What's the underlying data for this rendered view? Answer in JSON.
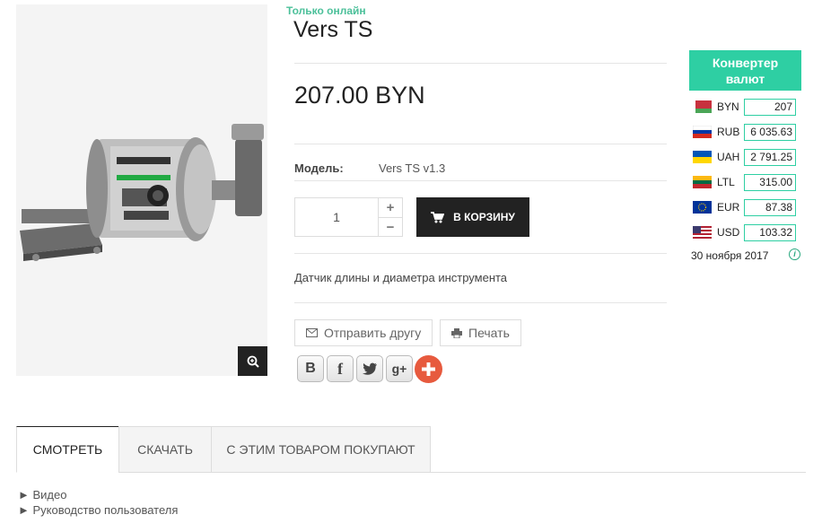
{
  "product": {
    "availability": "Только онлайн",
    "title": "Vers TS",
    "price": "207.00 BYN",
    "model_label": "Модель:",
    "model_value": "Vers TS v1.3",
    "quantity": "1",
    "qty_plus": "+",
    "qty_minus": "−",
    "cart_button": "В КОРЗИНУ",
    "description": "Датчик длины и диаметра инструмента",
    "send_friend": "Отправить другу",
    "print": "Печать"
  },
  "social": [
    "В",
    "f",
    "twitter",
    "g+",
    "+"
  ],
  "converter": {
    "title_line1": "Конвертер",
    "title_line2": "валют",
    "rows": [
      {
        "code": "BYN",
        "value": "207",
        "flag": "by"
      },
      {
        "code": "RUB",
        "value": "6 035.63",
        "flag": "ru"
      },
      {
        "code": "UAH",
        "value": "2 791.25",
        "flag": "ua"
      },
      {
        "code": "LTL",
        "value": "315.00",
        "flag": "lt"
      },
      {
        "code": "EUR",
        "value": "87.38",
        "flag": "eu"
      },
      {
        "code": "USD",
        "value": "103.32",
        "flag": "us"
      }
    ],
    "date": "30 ноября 2017",
    "info_icon": "i"
  },
  "tabs": [
    "СМОТРЕТЬ",
    "СКАЧАТЬ",
    "С ЭТИМ ТОВАРОМ ПОКУПАЮТ"
  ],
  "links": [
    "► Видео",
    "► Руководство пользователя"
  ],
  "icons": {
    "zoom": "zoom-in-icon",
    "cart": "cart-icon",
    "envelope": "envelope-icon",
    "print": "printer-icon"
  },
  "colors": {
    "accent": "#2ecfa3",
    "online": "#4cc09a",
    "dark_button": "#222222",
    "share_plus": "#e75a3e"
  }
}
